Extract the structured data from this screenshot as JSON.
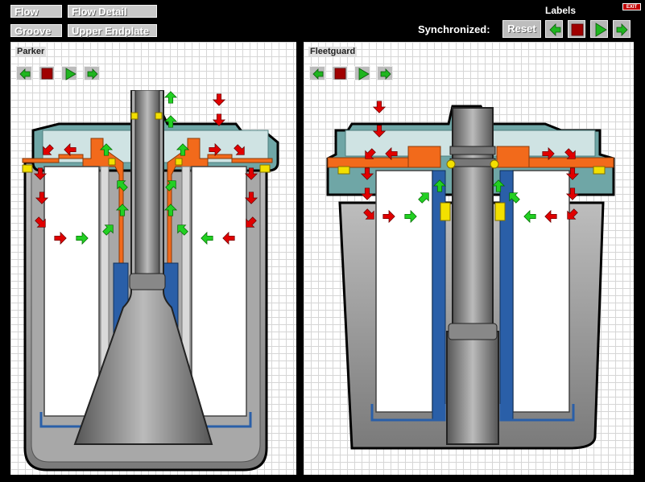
{
  "top_buttons": {
    "flow": "Flow",
    "flow_detail": "Flow Detail",
    "groove": "Groove",
    "upper_endplate": "Upper Endplate"
  },
  "labels_title": "Labels",
  "exit_label": "EXIT",
  "synchronized_label": "Synchronized:",
  "reset_label": "Reset",
  "panels": {
    "left": {
      "title": "Parker"
    },
    "right": {
      "title": "Fleetguard"
    }
  },
  "colors": {
    "flow_dirty": "#e00000",
    "flow_clean": "#00c000",
    "seal_orange": "#f26a1b",
    "housing_teal": "#6fa6a6",
    "media_blue": "#2a5fa8"
  },
  "icons": {
    "back": "green-left-arrow-icon",
    "stop": "red-square-stop-icon",
    "play": "green-play-icon",
    "forward": "green-right-arrow-icon"
  }
}
